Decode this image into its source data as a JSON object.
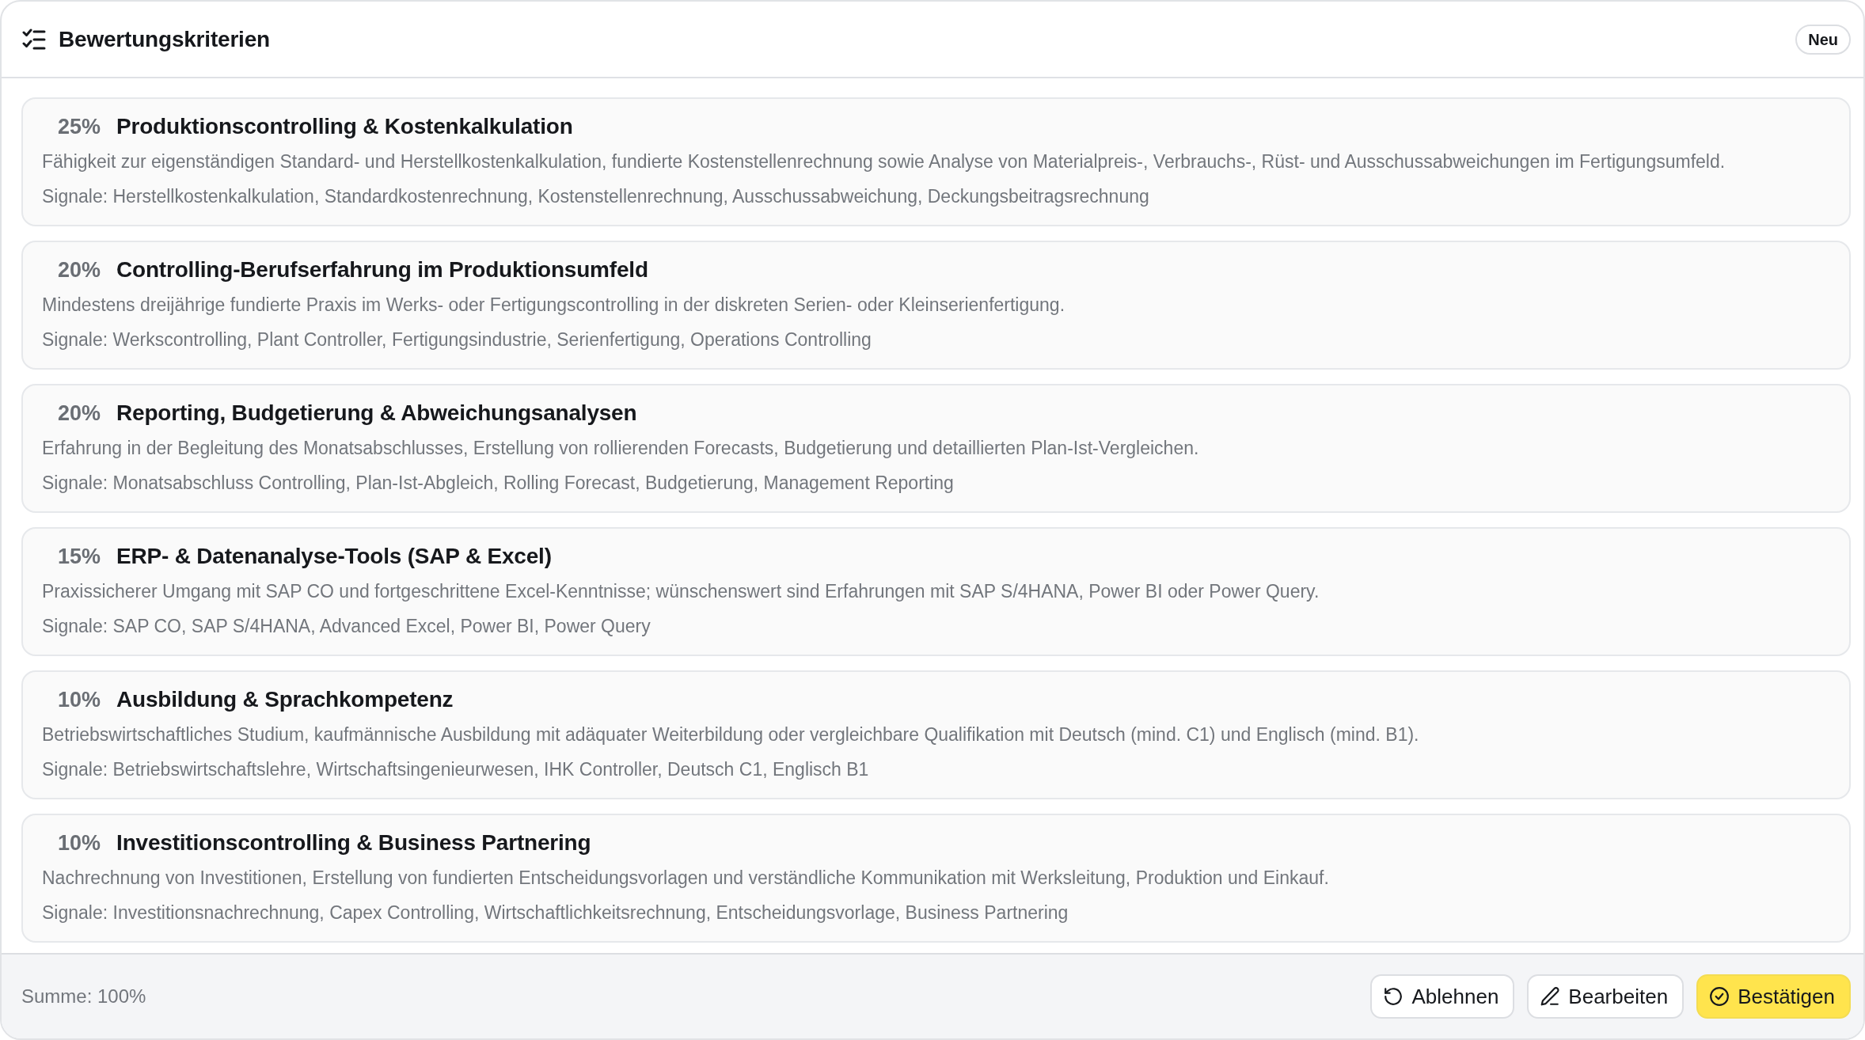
{
  "header": {
    "title": "Bewertungskriterien",
    "badge": "Neu"
  },
  "criteria": [
    {
      "weight": "25%",
      "title": "Produktionscontrolling & Kostenkalkulation",
      "description": "Fähigkeit zur eigenständigen Standard- und Herstellkostenkalkulation, fundierte Kostenstellenrechnung sowie Analyse von Materialpreis-, Verbrauchs-, Rüst- und Ausschussabweichungen im Fertigungsumfeld.",
      "signals": "Signale: Herstellkostenkalkulation, Standardkostenrechnung, Kostenstellenrechnung, Ausschussabweichung, Deckungsbeitragsrechnung"
    },
    {
      "weight": "20%",
      "title": "Controlling-Berufserfahrung im Produktionsumfeld",
      "description": "Mindestens dreijährige fundierte Praxis im Werks- oder Fertigungscontrolling in der diskreten Serien- oder Kleinserienfertigung.",
      "signals": "Signale: Werkscontrolling, Plant Controller, Fertigungsindustrie, Serienfertigung, Operations Controlling"
    },
    {
      "weight": "20%",
      "title": "Reporting, Budgetierung & Abweichungsanalysen",
      "description": "Erfahrung in der Begleitung des Monatsabschlusses, Erstellung von rollierenden Forecasts, Budgetierung und detaillierten Plan-Ist-Vergleichen.",
      "signals": "Signale: Monatsabschluss Controlling, Plan-Ist-Abgleich, Rolling Forecast, Budgetierung, Management Reporting"
    },
    {
      "weight": "15%",
      "title": "ERP- & Datenanalyse-Tools (SAP & Excel)",
      "description": "Praxissicherer Umgang mit SAP CO und fortgeschrittene Excel-Kenntnisse; wünschenswert sind Erfahrungen mit SAP S/4HANA, Power BI oder Power Query.",
      "signals": "Signale: SAP CO, SAP S/4HANA, Advanced Excel, Power BI, Power Query"
    },
    {
      "weight": "10%",
      "title": "Ausbildung & Sprachkompetenz",
      "description": "Betriebswirtschaftliches Studium, kaufmännische Ausbildung mit adäquater Weiterbildung oder vergleichbare Qualifikation mit Deutsch (mind. C1) und Englisch (mind. B1).",
      "signals": "Signale: Betriebswirtschaftslehre, Wirtschaftsingenieurwesen, IHK Controller, Deutsch C1, Englisch B1"
    },
    {
      "weight": "10%",
      "title": "Investitionscontrolling & Business Partnering",
      "description": "Nachrechnung von Investitionen, Erstellung von fundierten Entscheidungsvorlagen und verständliche Kommunikation mit Werksleitung, Produktion und Einkauf.",
      "signals": "Signale: Investitionsnachrechnung, Capex Controlling, Wirtschaftlichkeitsrechnung, Entscheidungsvorlage, Business Partnering"
    }
  ],
  "footer": {
    "sum": "Summe: 100%",
    "buttons": [
      {
        "kind": "reject",
        "label": "Ablehnen"
      },
      {
        "kind": "edit",
        "label": "Bearbeiten"
      },
      {
        "kind": "confirm",
        "label": "Bestätigen"
      }
    ]
  }
}
